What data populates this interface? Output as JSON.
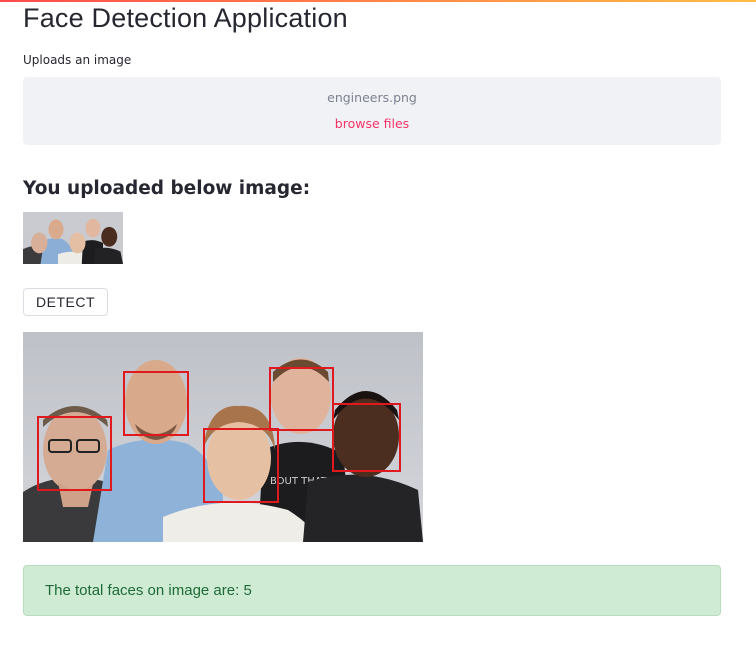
{
  "page": {
    "title": "Face Detection Application"
  },
  "uploader": {
    "label": "Uploads an image",
    "file_name": "engineers.png",
    "browse_label": "browse files"
  },
  "preview": {
    "heading": "You uploaded below image:"
  },
  "actions": {
    "detect_label": "DETECT"
  },
  "result": {
    "face_count": 5,
    "message": "The total faces on image are: 5"
  },
  "colors": {
    "accent": "#f63366",
    "detection_box": "#e0191f",
    "success_bg": "#d0ebd4",
    "success_text": "#1e6b37",
    "dropzone_bg": "#f0f2f6"
  }
}
